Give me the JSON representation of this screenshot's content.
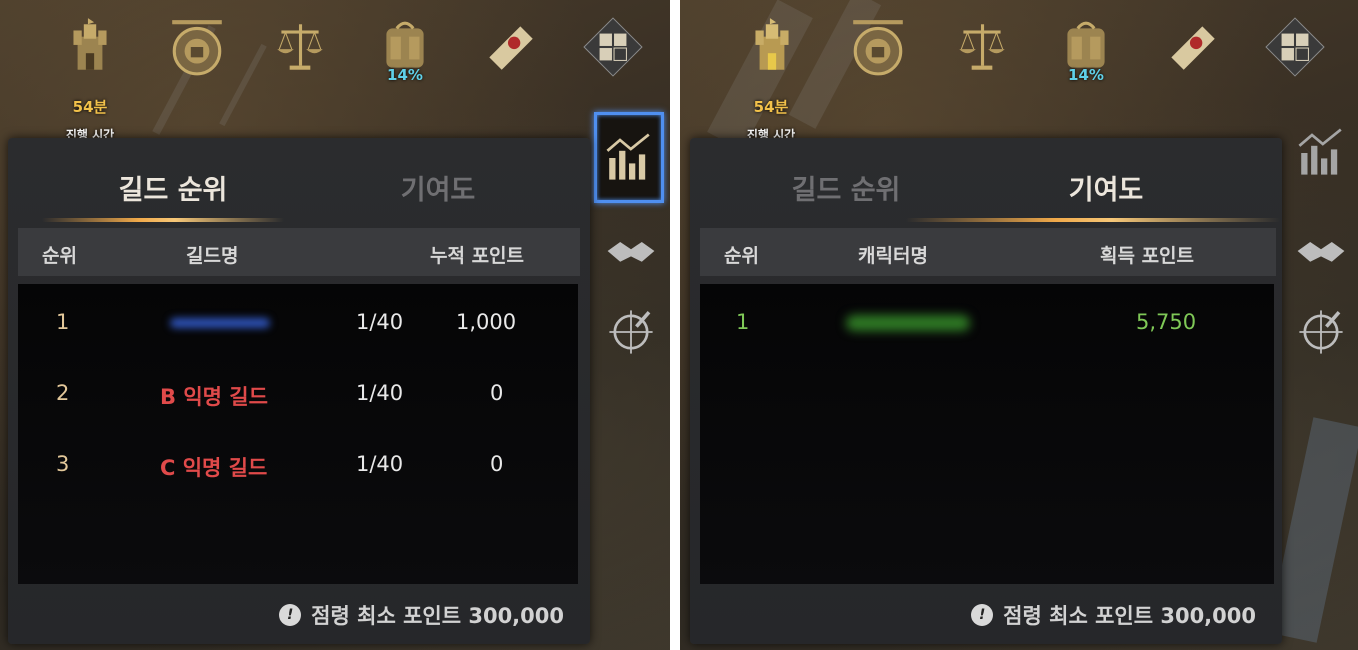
{
  "top_bar": {
    "time_value": "54분",
    "time_label": "진행 시간",
    "bag_percent": "14%"
  },
  "left_panel": {
    "tabs": [
      {
        "label": "길드 순위",
        "active": true
      },
      {
        "label": "기여도",
        "active": false
      }
    ],
    "headers": {
      "rank": "순위",
      "name": "길드명",
      "points": "누적 포인트"
    },
    "rows": [
      {
        "rank": "1",
        "guild": "",
        "count": "1/40",
        "points": "1,000"
      },
      {
        "rank": "2",
        "guild": "B 익명 길드",
        "count": "1/40",
        "points": "0"
      },
      {
        "rank": "3",
        "guild": "C 익명 길드",
        "count": "1/40",
        "points": "0"
      }
    ],
    "footer": "점령 최소 포인트 300,000"
  },
  "right_panel": {
    "tabs": [
      {
        "label": "길드 순위",
        "active": false
      },
      {
        "label": "기여도",
        "active": true
      }
    ],
    "headers": {
      "rank": "순위",
      "name": "캐릭터명",
      "points": "획득 포인트"
    },
    "rows": [
      {
        "rank": "1",
        "character": "",
        "points": "5,750"
      }
    ],
    "footer": "점령 최소 포인트 300,000"
  },
  "colors": {
    "gold": "#f2c14a",
    "cyan": "#5fd0e8",
    "red_guild": "#e04a4a",
    "green_rank": "#7fc857",
    "active_border": "#4f8ff0"
  }
}
